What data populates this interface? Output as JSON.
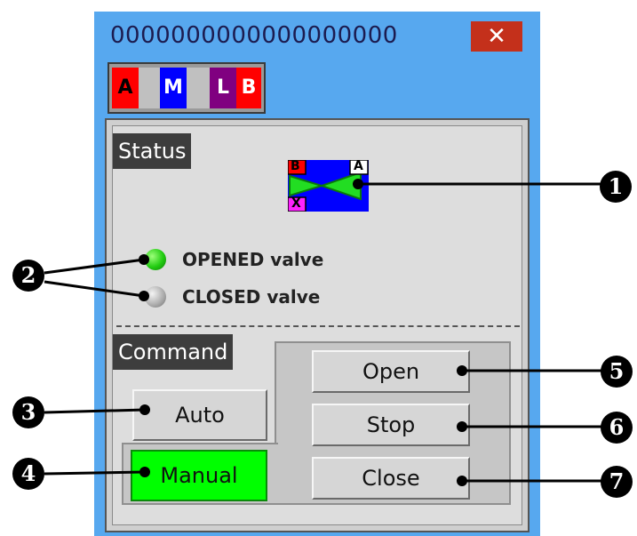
{
  "window": {
    "title": "0000000000000000000",
    "close_glyph": "✕"
  },
  "mode_strip": {
    "cells": [
      {
        "label": "A",
        "bg": "#ff0000",
        "color": "#000000"
      },
      {
        "label": "",
        "bg": "#c0c0c0",
        "color": "#000000"
      },
      {
        "label": "M",
        "bg": "#0000ff",
        "color": "#ffffff"
      },
      {
        "label": "",
        "bg": "#c0c0c0",
        "color": "#000000"
      },
      {
        "label": "L",
        "bg": "#800080",
        "color": "#ffffff"
      },
      {
        "label": "B",
        "bg": "#ff0000",
        "color": "#ffffff"
      }
    ]
  },
  "status": {
    "header": "Status",
    "symbol": {
      "tag_b": "B",
      "tag_x": "X",
      "tag_a": "A"
    },
    "opened_label": "OPENED valve",
    "closed_label": "CLOSED valve",
    "opened_color": "#22cc11",
    "closed_color": "#b0b0b0"
  },
  "command": {
    "header": "Command",
    "auto_label": "Auto",
    "manual_label": "Manual",
    "open_label": "Open",
    "stop_label": "Stop",
    "close_label": "Close",
    "active_color": "#00ff00"
  },
  "callouts": [
    "1",
    "2",
    "3",
    "4",
    "5",
    "6",
    "7"
  ]
}
